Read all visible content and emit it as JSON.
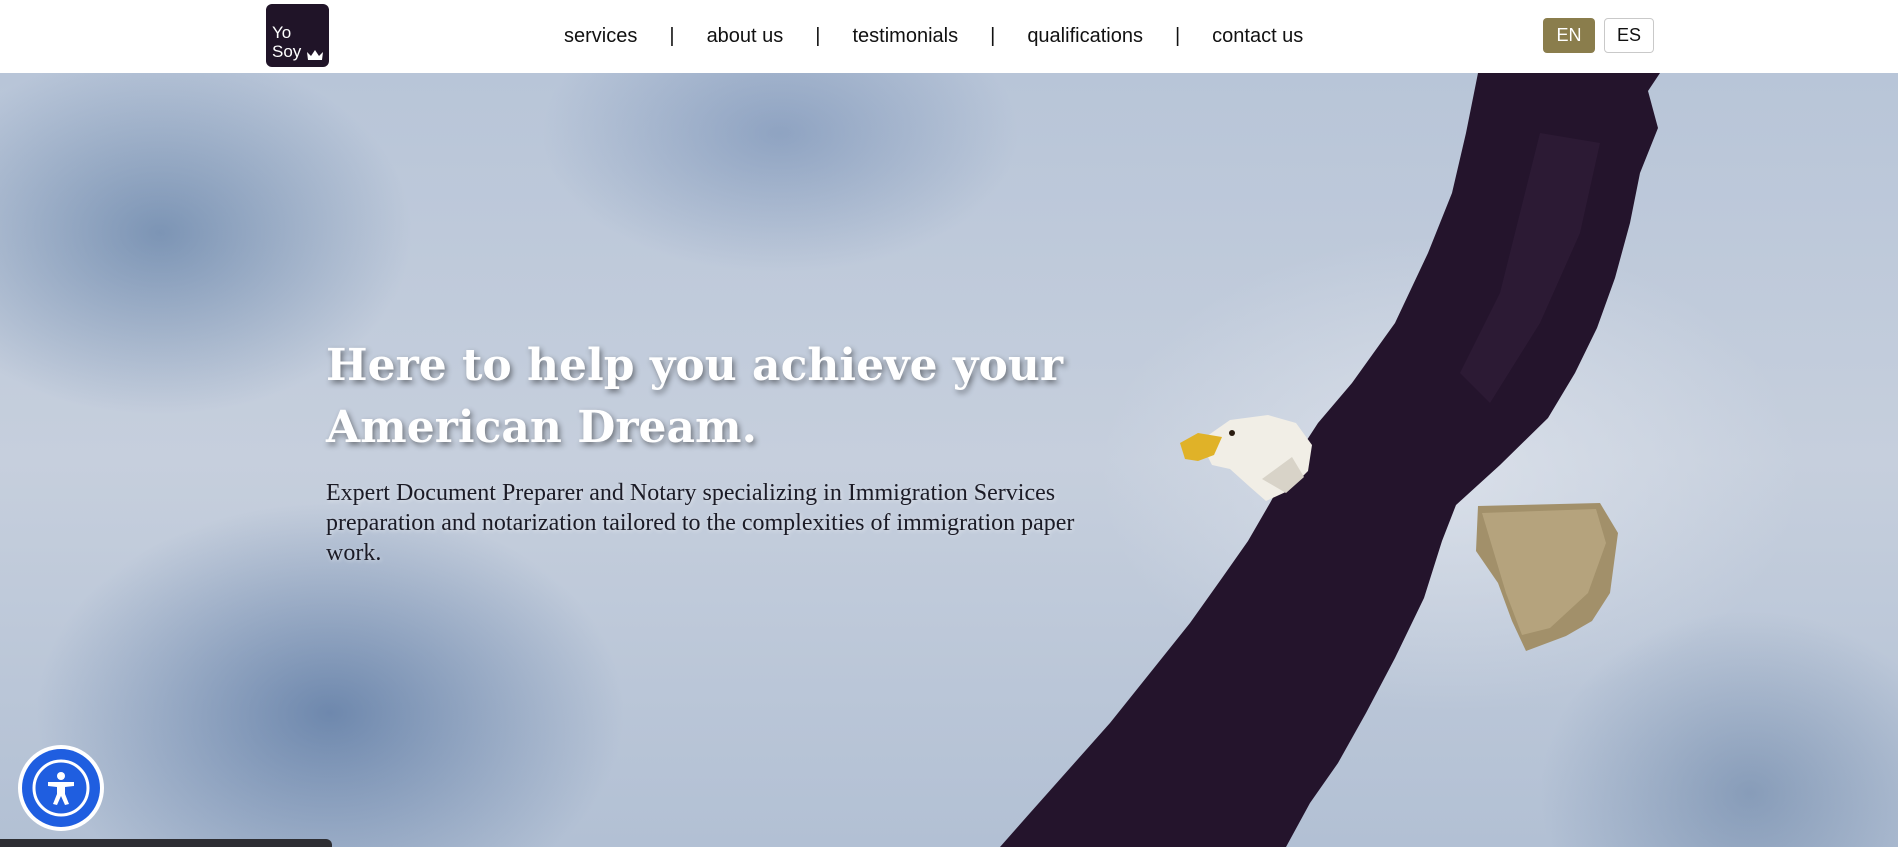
{
  "header": {
    "logo": {
      "line1": "Yo",
      "line2": "Soy",
      "icon": "crown-icon"
    },
    "nav": [
      {
        "label": "services"
      },
      {
        "label": "about us"
      },
      {
        "label": "testimonials"
      },
      {
        "label": "qualifications"
      },
      {
        "label": "contact us"
      }
    ],
    "separator": "|",
    "languages": {
      "active": "EN",
      "other": "ES"
    }
  },
  "hero": {
    "title": "Here to help you achieve your American Dream.",
    "description": "Expert Document Preparer and Notary specializing in Immigration Services preparation and notarization tailored to the complexities of immigration paper work.",
    "image": "bald-eagle-in-flight"
  },
  "widgets": {
    "accessibility_icon": "accessibility-icon"
  },
  "colors": {
    "logo_bg": "#201428",
    "active_lang_bg": "#8a7d4c",
    "accessibility_blue": "#1f5ee0",
    "eagle_body": "#24142c"
  }
}
